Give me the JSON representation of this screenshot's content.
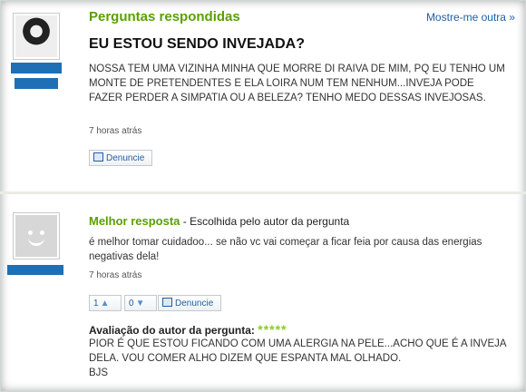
{
  "question": {
    "section_title": "Perguntas respondidas",
    "more_link": "Mostre-me outra",
    "more_arrow": "»",
    "title": "EU ESTOU SENDO INVEJADA?",
    "body": "NOSSA TEM UMA VIZINHA MINHA QUE MORRE DI RAIVA DE MIM, PQ EU TENHO UM MONTE DE PRETENDENTES E ELA LOIRA NUM TEM NENHUM...INVEJA PODE FAZER PERDER A SIMPATIA OU A BELEZA? TENHO MEDO DESSAS INVEJOSAS.",
    "time": "7 horas atrás",
    "report_label": "Denuncie"
  },
  "best_answer": {
    "title": "Melhor resposta",
    "subtitle": " - Escolhida pelo autor da pergunta",
    "body": "é melhor tomar cuidadoo... se não vc vai começar a ficar feia por causa das energias negativas dela!",
    "time": "7 horas atrás",
    "thumbs_up_count": "1",
    "thumbs_down_count": "0",
    "report_label": "Denuncie",
    "rating_label": "Avaliação do autor da pergunta:",
    "rating_stars": "*****",
    "rating_value": 5,
    "author_comment": "PIOR É QUE ESTOU FICANDO COM UMA ALERGIA NA PELE...ACHO QUE É A INVEJA DELA. VOU COMER ALHO DIZEM QUE ESPANTA MAL OLHADO.",
    "author_signoff": "BJS"
  },
  "colors": {
    "green": "#5aa000",
    "blue": "#1f5fa3",
    "namebar": "#1e6fb4",
    "stars": "#8acb2a"
  }
}
